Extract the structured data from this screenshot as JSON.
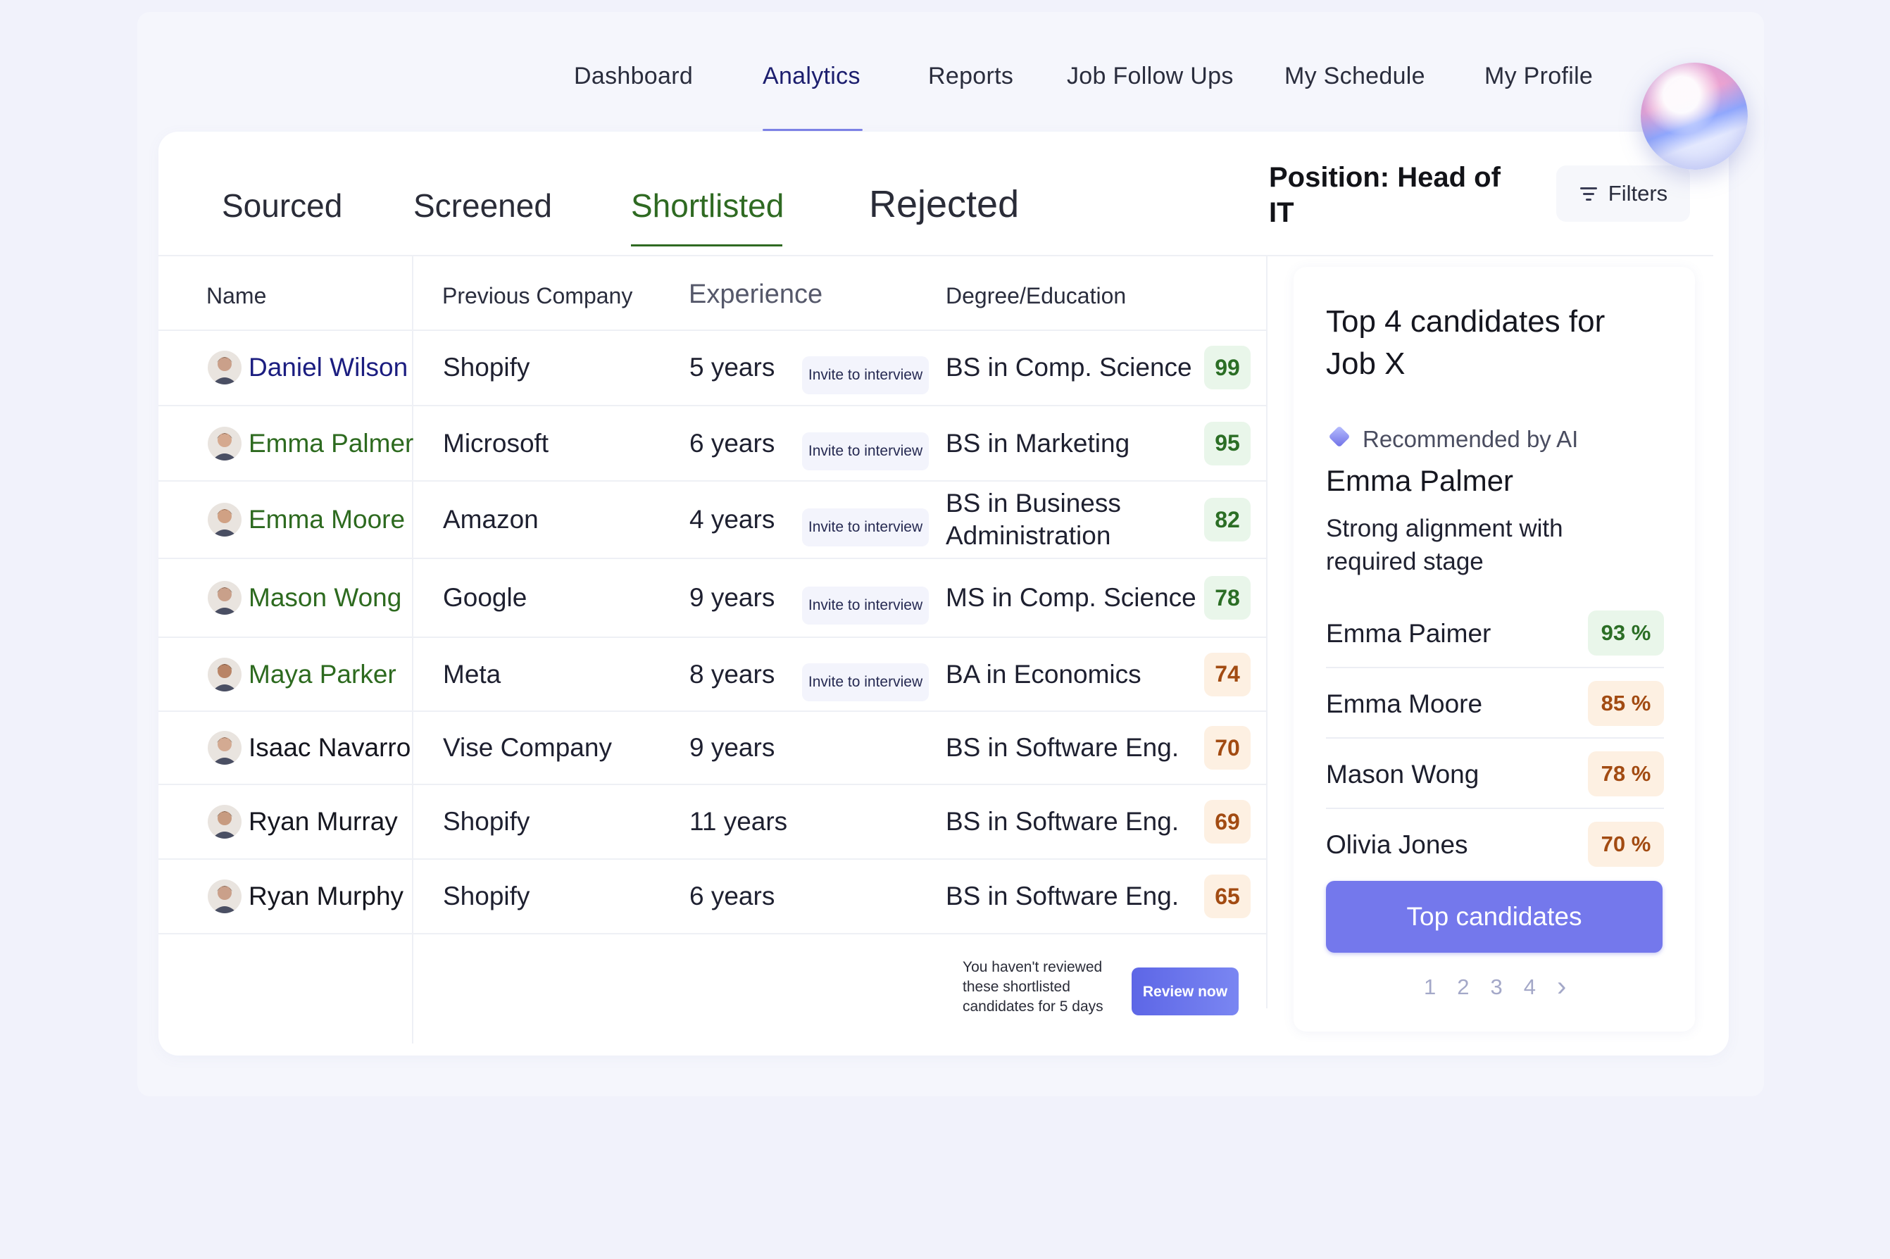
{
  "nav": {
    "items": [
      "Dashboard",
      "Analytics",
      "Reports",
      "Job Follow Ups",
      "My Schedule",
      "My Profile"
    ],
    "active": "Analytics"
  },
  "tabs": {
    "items": [
      "Sourced",
      "Screened",
      "Shortlisted",
      "Rejected"
    ],
    "active": "Shortlisted"
  },
  "position": "Position: Head of IT",
  "filters_label": "Filters",
  "table": {
    "headers": [
      "Name",
      "Previous Company",
      "Experience",
      "Degree/Education"
    ],
    "invite_label": "Invite to interview",
    "rows": [
      {
        "name": "Daniel Wilson",
        "company": "Shopify",
        "experience": "5 years",
        "degree": "BS in Comp. Science",
        "score": "99",
        "invite": true
      },
      {
        "name": "Emma Palmer",
        "company": "Microsoft",
        "experience": "6 years",
        "degree": "BS in Marketing",
        "score": "95",
        "invite": true
      },
      {
        "name": "Emma Moore",
        "company": "Amazon",
        "experience": "4 years",
        "degree": "BS in Business Administration",
        "score": "82",
        "invite": true
      },
      {
        "name": "Mason Wong",
        "company": "Google",
        "experience": "9 years",
        "degree": "MS in Comp. Science",
        "score": "78",
        "invite": true
      },
      {
        "name": "Maya Parker",
        "company": "Meta",
        "experience": "8 years",
        "degree": "BA in Economics",
        "score": "74",
        "invite": true
      },
      {
        "name": "Isaac Navarro",
        "company": "Vise Company",
        "experience": "9 years",
        "degree": "BS in Software Eng.",
        "score": "70",
        "invite": false
      },
      {
        "name": "Ryan Murray",
        "company": "Shopify",
        "experience": "11 years",
        "degree": "BS in Software Eng.",
        "score": "69",
        "invite": false
      },
      {
        "name": "Ryan Murphy",
        "company": "Shopify",
        "experience": "6 years",
        "degree": "BS in Software Eng.",
        "score": "65",
        "invite": false
      }
    ]
  },
  "review": {
    "message": "You haven't reviewed these shortlisted candidates for 5 days",
    "button": "Review now"
  },
  "panel": {
    "title": "Top 4 candidates for Job X",
    "ai_label": "Recommended by AI",
    "featured_name": "Emma Palmer",
    "featured_reason": "Strong alignment with required stage",
    "candidates": [
      {
        "name": "Emma Paimer",
        "pct": "93 %"
      },
      {
        "name": "Emma Moore",
        "pct": "85 %"
      },
      {
        "name": "Mason Wong",
        "pct": "78 %"
      },
      {
        "name": "Olivia Jones",
        "pct": "70 %"
      }
    ],
    "button": "Top candidates",
    "pages": [
      "1",
      "2",
      "3",
      "4"
    ],
    "next": "›"
  },
  "colors": {
    "accent": "#7478ec",
    "shortlist_green": "#2f6a22",
    "score_green_bg": "#e9f6ea",
    "score_orange_bg": "#fdf0e2"
  }
}
